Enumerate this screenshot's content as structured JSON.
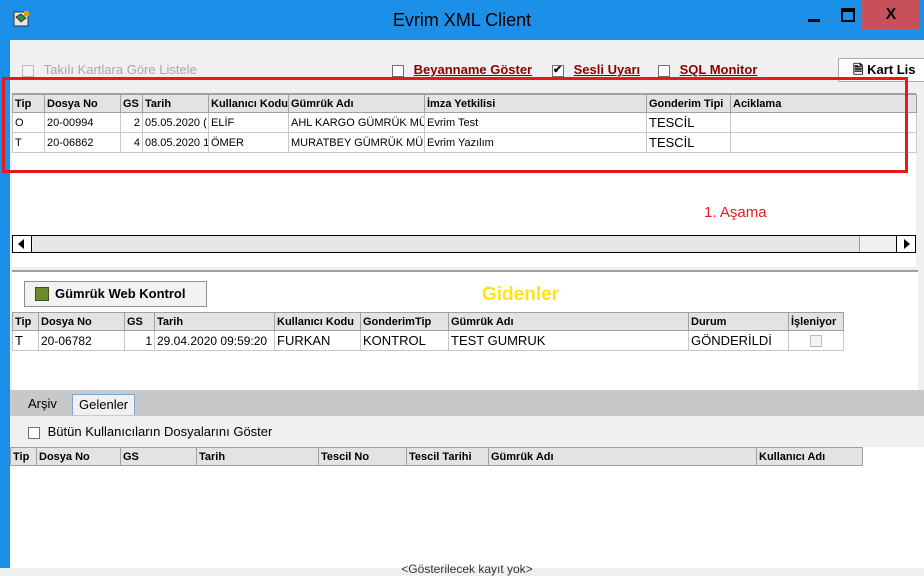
{
  "window": {
    "title": "Evrim XML Client",
    "minimize": "_",
    "close": "X"
  },
  "options": {
    "takili": "Takılı Kartlara Göre Listele",
    "beyanname": "Beyanname Göster",
    "sesli": "Sesli Uyarı",
    "sql": "SQL Monitor",
    "kart_button": "Kart Lis"
  },
  "grid1": {
    "columns": [
      "Tip",
      "Dosya No",
      "GS",
      "Tarih",
      "Kullanıcı Kodu",
      "Gümrük Adı",
      "İmza Yetkilisi",
      "Gonderim Tipi",
      "Aciklama"
    ],
    "rows": [
      [
        "O",
        "20-00994",
        "2",
        "05.05.2020 (",
        "ELİF",
        "AHL KARGO GÜMRÜK MÜD",
        "Evrim Test",
        "TESCİL",
        ""
      ],
      [
        "T",
        "20-06862",
        "4",
        "08.05.2020 1",
        "ÖMER",
        "MURATBEY GÜMRÜK MÜD",
        "Evrim Yazılım",
        "TESCİL",
        ""
      ]
    ]
  },
  "annotation": "1. Aşama",
  "gidenler": {
    "button": "Gümrük Web Kontrol",
    "title": "Gidenler",
    "columns": [
      "Tip",
      "Dosya No",
      "GS",
      "Tarih",
      "Kullanıcı Kodu",
      "GonderimTip",
      "Gümrük Adı",
      "Durum",
      "İşleniyor"
    ],
    "rows": [
      [
        "T",
        "20-06782",
        "1",
        "29.04.2020 09:59:20",
        "FURKAN",
        "KONTROL",
        "TEST GUMRUK",
        "GÖNDERİLDİ",
        ""
      ]
    ]
  },
  "tabs": [
    "Arşiv",
    "Gelenler"
  ],
  "gelenler": {
    "all_users": "Bütün Kullanıcıların Dosyalarını Göster",
    "columns": [
      "Tip",
      "Dosya No",
      "GS",
      "Tarih",
      "Tescil No",
      "Tescil Tarihi",
      "Gümrük Adı",
      "Kullanıcı Adı"
    ],
    "empty": "<Gösterilecek kayıt yok>"
  },
  "colors": {
    "frame": "#1c8fe8",
    "annotation": "#e31b1b",
    "gidenler_title": "#ffe40f"
  }
}
